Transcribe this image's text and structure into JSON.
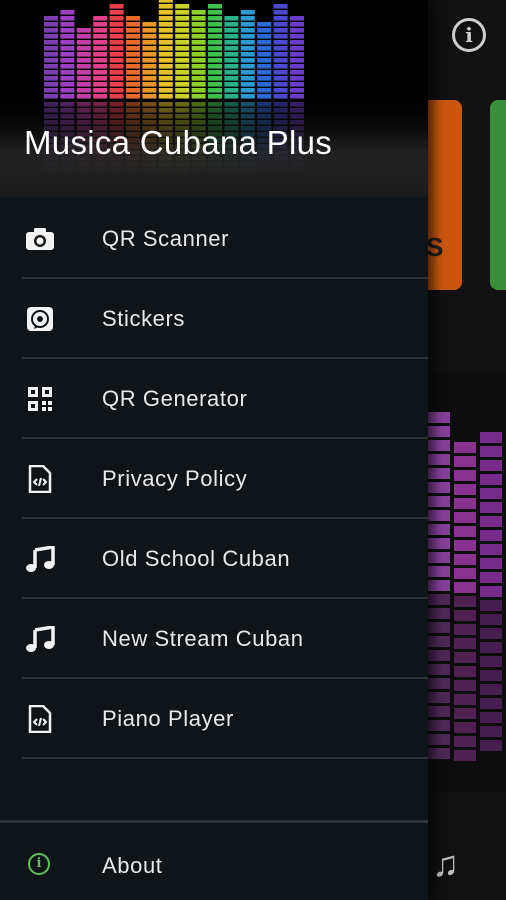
{
  "app": {
    "title": "Musica Cubana Plus",
    "info_icon": "info-icon",
    "bg_card_text": "S",
    "bg_tab_icon": "music-note-icon"
  },
  "drawer": {
    "items": [
      {
        "label": "QR Scanner",
        "icon": "camera-icon"
      },
      {
        "label": "Stickers",
        "icon": "whatsapp-icon"
      },
      {
        "label": "QR Generator",
        "icon": "qr-code-icon"
      },
      {
        "label": "Privacy Policy",
        "icon": "code-file-icon"
      },
      {
        "label": "Old School Cuban",
        "icon": "music-note-icon"
      },
      {
        "label": "New Stream Cuban",
        "icon": "music-note-icon"
      },
      {
        "label": "Piano Player",
        "icon": "code-file-icon"
      }
    ],
    "about": {
      "label": "About",
      "icon": "info-icon"
    }
  },
  "colors": {
    "drawer_bg": "#0f1418",
    "separator": "#2d3236",
    "about_icon": "#5fbf5f",
    "card_orange": "#c8560e",
    "card_green": "#3a8f3a"
  }
}
